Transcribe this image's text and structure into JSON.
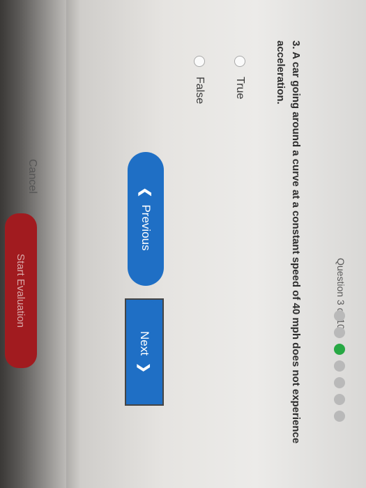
{
  "header": {
    "progress_text": "Question 3 of 10",
    "dots": [
      {
        "state": "done"
      },
      {
        "state": "done"
      },
      {
        "state": "current"
      },
      {
        "state": "pending"
      },
      {
        "state": "pending"
      },
      {
        "state": "pending"
      },
      {
        "state": "pending"
      }
    ]
  },
  "question": {
    "text": "3. A car going around a curve at a constant speed of 40 mph does not experience acceleration."
  },
  "options": [
    {
      "label": "True"
    },
    {
      "label": "False"
    }
  ],
  "nav": {
    "previous_label": "Previous",
    "next_label": "Next"
  },
  "footer": {
    "cancel_label": "Cancel",
    "start_label": "Start Evaluation"
  },
  "colors": {
    "accent": "#1f6fc5",
    "current_dot": "#27a844",
    "danger": "#a11b1f"
  },
  "icons": {
    "previous": "chevron-left-icon",
    "next": "chevron-right-icon"
  }
}
